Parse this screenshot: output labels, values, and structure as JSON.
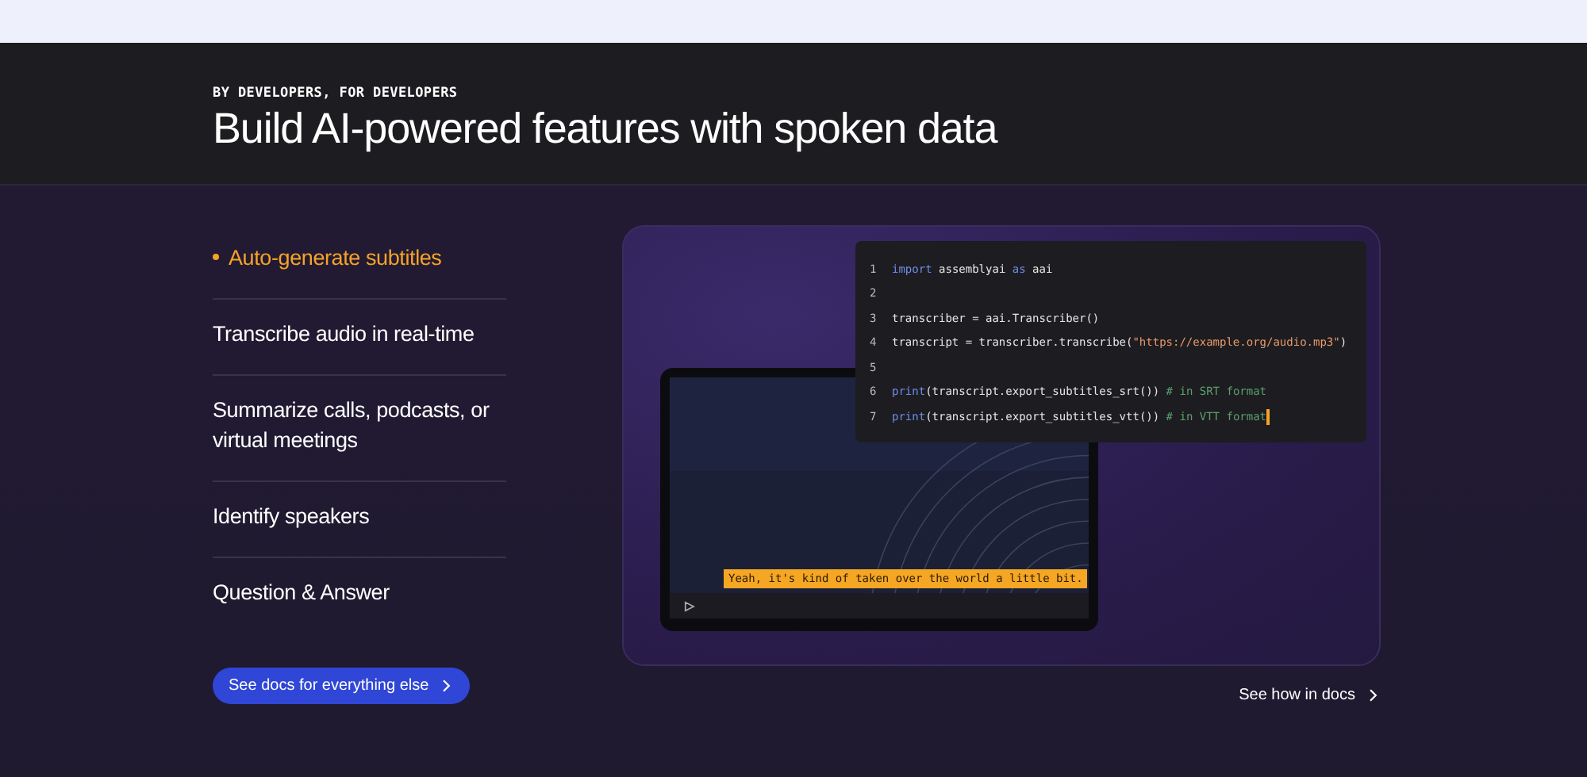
{
  "header": {
    "eyebrow": "BY DEVELOPERS, FOR DEVELOPERS",
    "title": "Build AI-powered features with spoken data"
  },
  "features": [
    {
      "label": "Auto-generate subtitles",
      "selected": true
    },
    {
      "label": "Transcribe audio in real-time",
      "selected": false
    },
    {
      "label": "Summarize calls, podcasts, or virtual meetings",
      "selected": false
    },
    {
      "label": "Identify speakers",
      "selected": false
    },
    {
      "label": "Question & Answer",
      "selected": false
    }
  ],
  "docs_button": {
    "label": "See docs for everything else"
  },
  "demo": {
    "video": {
      "subtitle": "Yeah, it's kind of taken over the world a little bit."
    },
    "code": [
      {
        "number": "1",
        "cursor": false,
        "tokens": [
          {
            "kind": "keyword",
            "text": "import"
          },
          {
            "kind": "plain",
            "text": " assemblyai "
          },
          {
            "kind": "keyword",
            "text": "as"
          },
          {
            "kind": "plain",
            "text": " aai"
          }
        ]
      },
      {
        "number": "2",
        "cursor": false
      },
      {
        "number": "3",
        "cursor": false,
        "tokens": [
          {
            "kind": "plain",
            "text": "transcriber = aai.Transcriber()"
          }
        ]
      },
      {
        "number": "4",
        "cursor": false,
        "tokens": [
          {
            "kind": "plain",
            "text": "transcript = transcriber.transcribe("
          },
          {
            "kind": "string",
            "text": "\"https://example.org/audio.mp3\""
          },
          {
            "kind": "plain",
            "text": ")"
          }
        ]
      },
      {
        "number": "5",
        "cursor": false
      },
      {
        "number": "6",
        "cursor": false,
        "tokens": [
          {
            "kind": "function",
            "text": "print"
          },
          {
            "kind": "plain",
            "text": "(transcript.export_subtitles_srt()) "
          },
          {
            "kind": "comment",
            "text": "# in SRT format"
          }
        ]
      },
      {
        "number": "7",
        "cursor": true,
        "tokens": [
          {
            "kind": "function",
            "text": "print"
          },
          {
            "kind": "plain",
            "text": "(transcript.export_subtitles_vtt()) "
          },
          {
            "kind": "comment",
            "text": "# in VTT format"
          }
        ]
      }
    ]
  },
  "docs_link": {
    "label": "See how in docs"
  }
}
